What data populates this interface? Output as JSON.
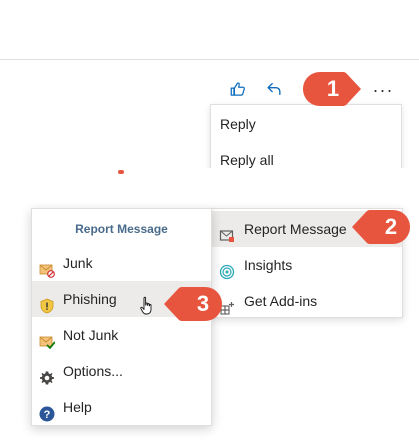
{
  "toolbar": {
    "icons": [
      "thumbs-up-icon",
      "reply-icon",
      "reply-all-icon",
      "more-icon"
    ],
    "more_label": "···"
  },
  "dropdown": {
    "items": [
      {
        "label": "Reply"
      },
      {
        "label": "Reply all"
      }
    ]
  },
  "addins_menu": {
    "items": [
      {
        "label": "Report Message",
        "icon": "report-message-icon",
        "highlighted": true
      },
      {
        "label": "Insights",
        "icon": "insights-icon",
        "highlighted": false
      },
      {
        "label": "Get Add-ins",
        "icon": "get-addins-icon",
        "highlighted": false
      }
    ]
  },
  "report_panel": {
    "title": "Report Message",
    "items": [
      {
        "label": "Junk",
        "icon": "junk-icon",
        "highlighted": false
      },
      {
        "label": "Phishing",
        "icon": "shield-warning-icon",
        "highlighted": true
      },
      {
        "label": "Not Junk",
        "icon": "not-junk-icon",
        "highlighted": false
      },
      {
        "label": "Options...",
        "icon": "gear-icon",
        "highlighted": false
      },
      {
        "label": "Help",
        "icon": "help-icon",
        "highlighted": false
      }
    ]
  },
  "callouts": [
    {
      "number": "1"
    },
    {
      "number": "2"
    },
    {
      "number": "3"
    }
  ],
  "colors": {
    "callout": "#e8553f",
    "accent_blue": "#0f6cbd",
    "panel_title": "#486b8b",
    "highlight": "#edebe9"
  }
}
